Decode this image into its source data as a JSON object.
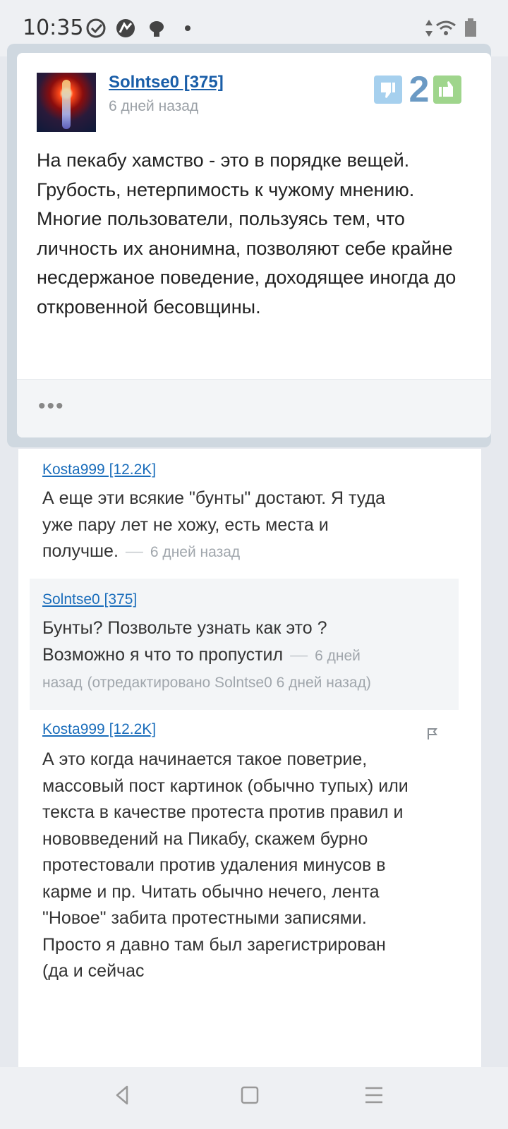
{
  "status_bar": {
    "time": "10:35",
    "icons": [
      "check-circle-icon",
      "bird-icon",
      "bug-icon",
      "dot-icon",
      "signal-arrows-icon",
      "wifi-icon",
      "battery-icon"
    ]
  },
  "post": {
    "author": "Solntse0 [375]",
    "time": "6 дней назад",
    "rating": "2",
    "text": "На пекабу хамство - это в порядке вещей. Грубость, нетерпимость к чужому мнению. Многие пользователи, пользуясь тем, что личность их анонимна, позволяют себе крайне несдержаное поведение, доходящее иногда до откровенной бесовщины.",
    "more": "•••"
  },
  "comments": [
    {
      "author": "Kosta999 [12.2K]",
      "text": "А еще эти всякие \"бунты\" достают. Я туда уже пару лет не хожу, есть места и получше.",
      "dash": "—",
      "time": "6 дней назад"
    },
    {
      "author": "Solntse0 [375]",
      "text": "Бунты? Позвольте узнать как это ? Возможно я что то пропустил",
      "dash": "—",
      "time": "6 дней назад",
      "edited": "(отредактировано Solntse0 6 дней назад)"
    },
    {
      "author": "Kosta999 [12.2K]",
      "text": "А это когда начинается такое поветрие, массовый пост картинок (обычно тупых) или текста в качестве протеста против правил и нововведений на Пикабу, скажем бурно протестовали против удаления минусов в карме и пр. Читать обычно нечего, лента \"Новое\" забита протестными записями.\nПросто я давно там был зарегистрирован (да и сейчас"
    }
  ],
  "nav": {
    "back": "back-icon",
    "home": "home-icon",
    "menu": "menu-icon"
  },
  "colors": {
    "link": "#1a6dbb",
    "vote_down": "#a6d0ee",
    "vote_up": "#9fd58c",
    "rating": "#6b9ac4"
  }
}
